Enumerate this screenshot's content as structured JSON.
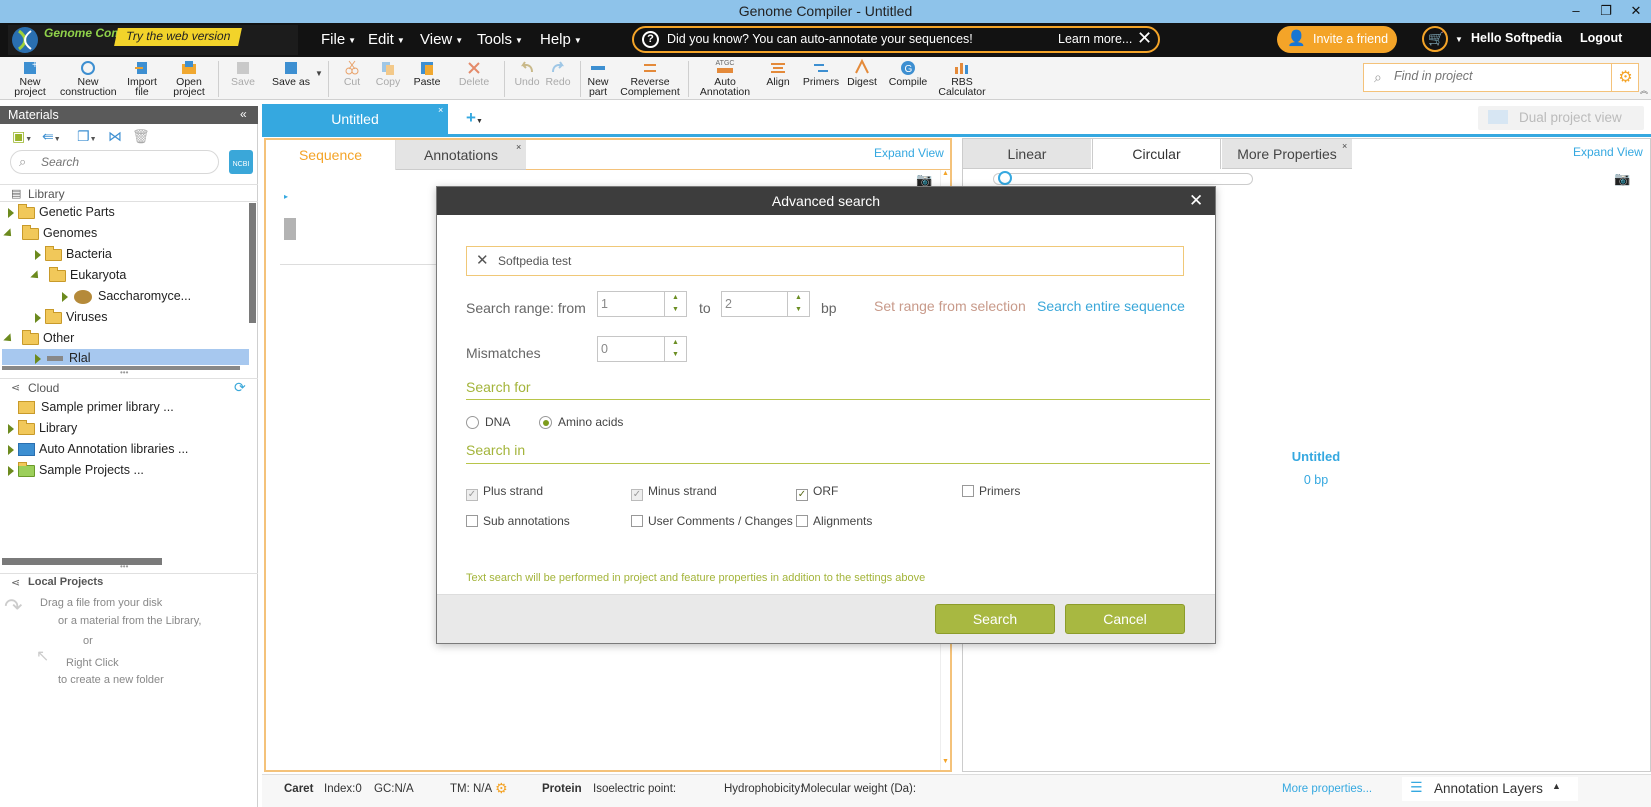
{
  "window": {
    "title": "Genome Compiler - Untitled",
    "controls": [
      "–",
      "❐",
      "✕"
    ]
  },
  "logo": {
    "name": "Genome Compiler",
    "web_banner": "Try the web version"
  },
  "menubar": {
    "items": [
      "File",
      "Edit",
      "View",
      "Tools",
      "Help"
    ],
    "tip_text": "Did you know? You can auto-annotate  your sequences!",
    "tip_link": "Learn more...",
    "invite": "Invite a friend",
    "greeting": "Hello Softpedia",
    "logout": "Logout"
  },
  "toolbar": {
    "new_project": [
      "New",
      "project"
    ],
    "new_construction": [
      "New",
      "construction"
    ],
    "import_file": [
      "Import",
      "file"
    ],
    "open_project": [
      "Open",
      "project"
    ],
    "save": "Save",
    "save_as": "Save as",
    "cut": "Cut",
    "copy": "Copy",
    "paste": "Paste",
    "delete": "Delete",
    "undo": "Undo",
    "redo": "Redo",
    "new_part": [
      "New",
      "part"
    ],
    "reverse_complement": [
      "Reverse",
      "Complement"
    ],
    "auto_annotation_top": "ATGC",
    "auto_annotation": [
      "Auto",
      "Annotation"
    ],
    "align": "Align",
    "primers": "Primers",
    "digest": "Digest",
    "compile": "Compile",
    "rbs_calculator": [
      "RBS",
      "Calculator"
    ],
    "find_placeholder": "Find in project"
  },
  "materials": {
    "title": "Materials",
    "search_placeholder": "Search",
    "ncbi": "NCBI",
    "library_label": "Library",
    "library_items": [
      {
        "label": "Genetic Parts"
      },
      {
        "label": "Genomes"
      },
      {
        "label": "Bacteria"
      },
      {
        "label": "Eukaryota"
      },
      {
        "label": "Saccharomyce..."
      },
      {
        "label": "Viruses"
      },
      {
        "label": "Other"
      },
      {
        "label": "Rlal"
      }
    ],
    "cloud_label": "Cloud",
    "cloud_items": [
      {
        "label": "Sample primer library ..."
      },
      {
        "label": "Library"
      },
      {
        "label": "Auto Annotation libraries ..."
      },
      {
        "label": "Sample Projects ..."
      }
    ],
    "local_label": "Local Projects",
    "local_hint": [
      "Drag a file from your disk",
      "or a material from the Library,",
      "or",
      "Right Click",
      "to create a new folder"
    ]
  },
  "project_tabs": {
    "active": "Untitled",
    "add": "+",
    "dual_view": "Dual project view"
  },
  "left_view": {
    "tabs": [
      "Sequence",
      "Annotations"
    ],
    "expand": "Expand View"
  },
  "right_view": {
    "tabs": [
      "Linear",
      "Circular",
      "More Properties"
    ],
    "expand": "Expand View",
    "plasmid_name": "Untitled",
    "plasmid_length": "0 bp"
  },
  "dialog": {
    "title": "Advanced search",
    "query": "Softpedia test",
    "range_label": "Search range: from",
    "from_value": "1",
    "to_label": "to",
    "to_value": "2",
    "unit": "bp",
    "set_range": "Set range from selection",
    "search_entire": "Search entire sequence",
    "mismatches_label": "Mismatches",
    "mismatches_value": "0",
    "search_for_label": "Search for",
    "search_for_options": [
      {
        "label": "DNA",
        "selected": false
      },
      {
        "label": "Amino acids",
        "selected": true
      }
    ],
    "search_in_label": "Search in",
    "search_in_options": [
      {
        "label": "Plus strand",
        "checked": true,
        "disabled": true
      },
      {
        "label": "Minus strand",
        "checked": true,
        "disabled": true
      },
      {
        "label": "ORF",
        "checked": true,
        "disabled": false
      },
      {
        "label": "Primers",
        "checked": false,
        "disabled": false
      },
      {
        "label": "Sub annotations",
        "checked": false,
        "disabled": false
      },
      {
        "label": "User Comments / Changes",
        "checked": false,
        "disabled": false
      },
      {
        "label": "Alignments",
        "checked": false,
        "disabled": false
      }
    ],
    "note": "Text search will be performed in project and feature properties in addition to the settings above",
    "search_button": "Search",
    "cancel_button": "Cancel"
  },
  "statusbar": {
    "caret": "Caret",
    "index": "Index:0",
    "gc": "GC:N/A",
    "tm": "TM: N/A",
    "protein": "Protein",
    "isoelectric": "Isoelectric point:",
    "hydrophobicity": "Hydrophobicity:",
    "molecular_weight": "Molecular weight (Da):",
    "more_properties": "More properties...",
    "annotation_layers": "Annotation Layers"
  },
  "colors": {
    "accent_green": "#a8b841",
    "accent_orange": "#f4a428",
    "link_blue": "#3aa7d9",
    "tab_blue": "#35a8e0"
  }
}
